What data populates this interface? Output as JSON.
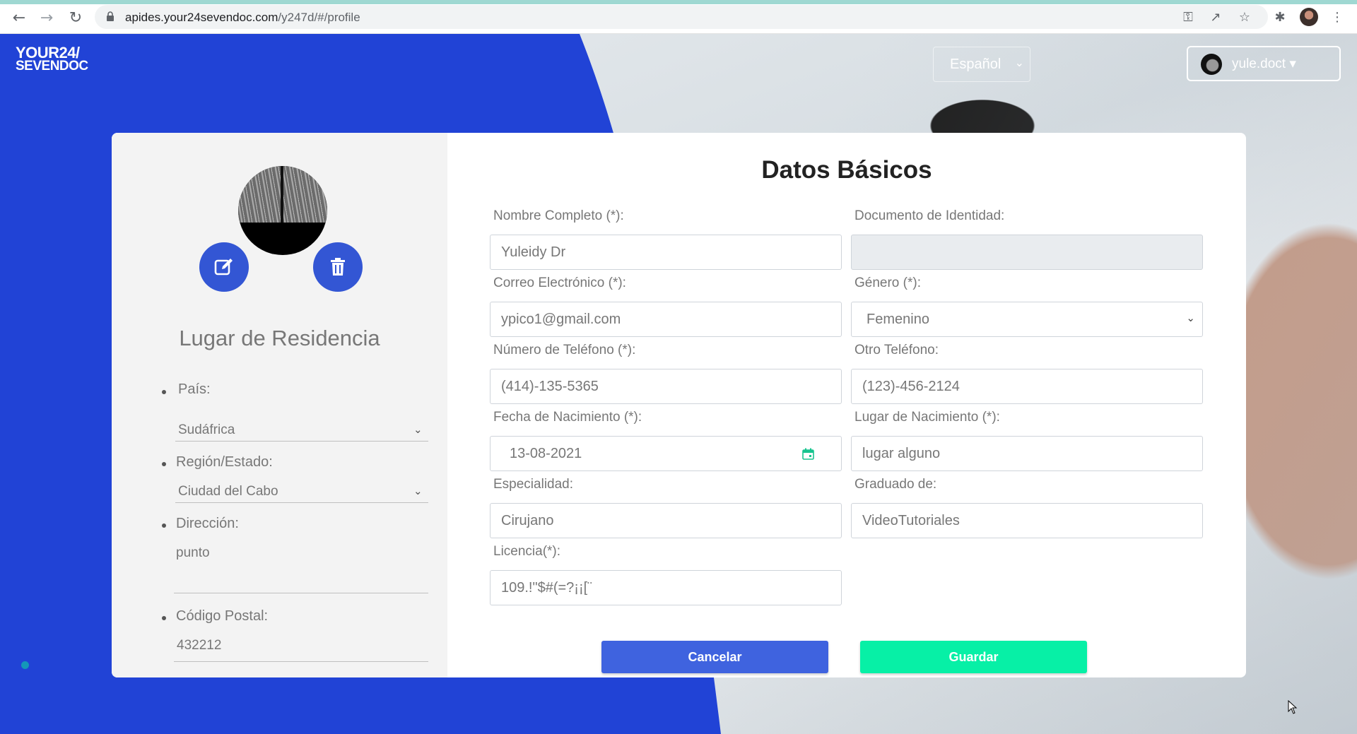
{
  "browser": {
    "url_host": "apides.your24sevendoc.com",
    "url_path": "/y247d/#/profile"
  },
  "header": {
    "logo_line1": "YOUR24/",
    "logo_line2": "SEVENDOC",
    "language": "Español",
    "user_name": "yule.doct"
  },
  "residence": {
    "title": "Lugar de Residencia",
    "country_label": "País:",
    "country_value": "Sudáfrica",
    "region_label": "Región/Estado:",
    "region_value": "Ciudad del Cabo",
    "address_label": "Dirección:",
    "address_value": "punto",
    "postal_label": "Código Postal:",
    "postal_value": "432212"
  },
  "form": {
    "title": "Datos Básicos",
    "full_name_label": "Nombre Completo (*):",
    "full_name_value": "Yuleidy Dr",
    "id_doc_label": "Documento de Identidad:",
    "id_doc_value": "",
    "email_label": "Correo Electrónico (*):",
    "email_value": "ypico1@gmail.com",
    "gender_label": "Género (*):",
    "gender_value": "Femenino",
    "phone_label": "Número de Teléfono (*):",
    "phone_value": "(414)-135-5365",
    "other_phone_label": "Otro Teléfono:",
    "other_phone_value": "(123)-456-2124",
    "birth_date_label": "Fecha de Nacimiento (*):",
    "birth_date_value": "13-08-2021",
    "birth_place_label": "Lugar de Nacimiento (*):",
    "birth_place_value": "lugar alguno",
    "specialty_label": "Especialidad:",
    "specialty_value": "Cirujano",
    "graduated_label": "Graduado de:",
    "graduated_value": "VideoTutoriales",
    "license_label": "Licencia(*):",
    "license_value": "109.!\"$#(=?¡¡[¨",
    "cancel_label": "Cancelar",
    "save_label": "Guardar"
  },
  "colors": {
    "brand_blue": "#2143d6",
    "button_blue": "#3f63df",
    "button_green": "#07f0a6"
  }
}
